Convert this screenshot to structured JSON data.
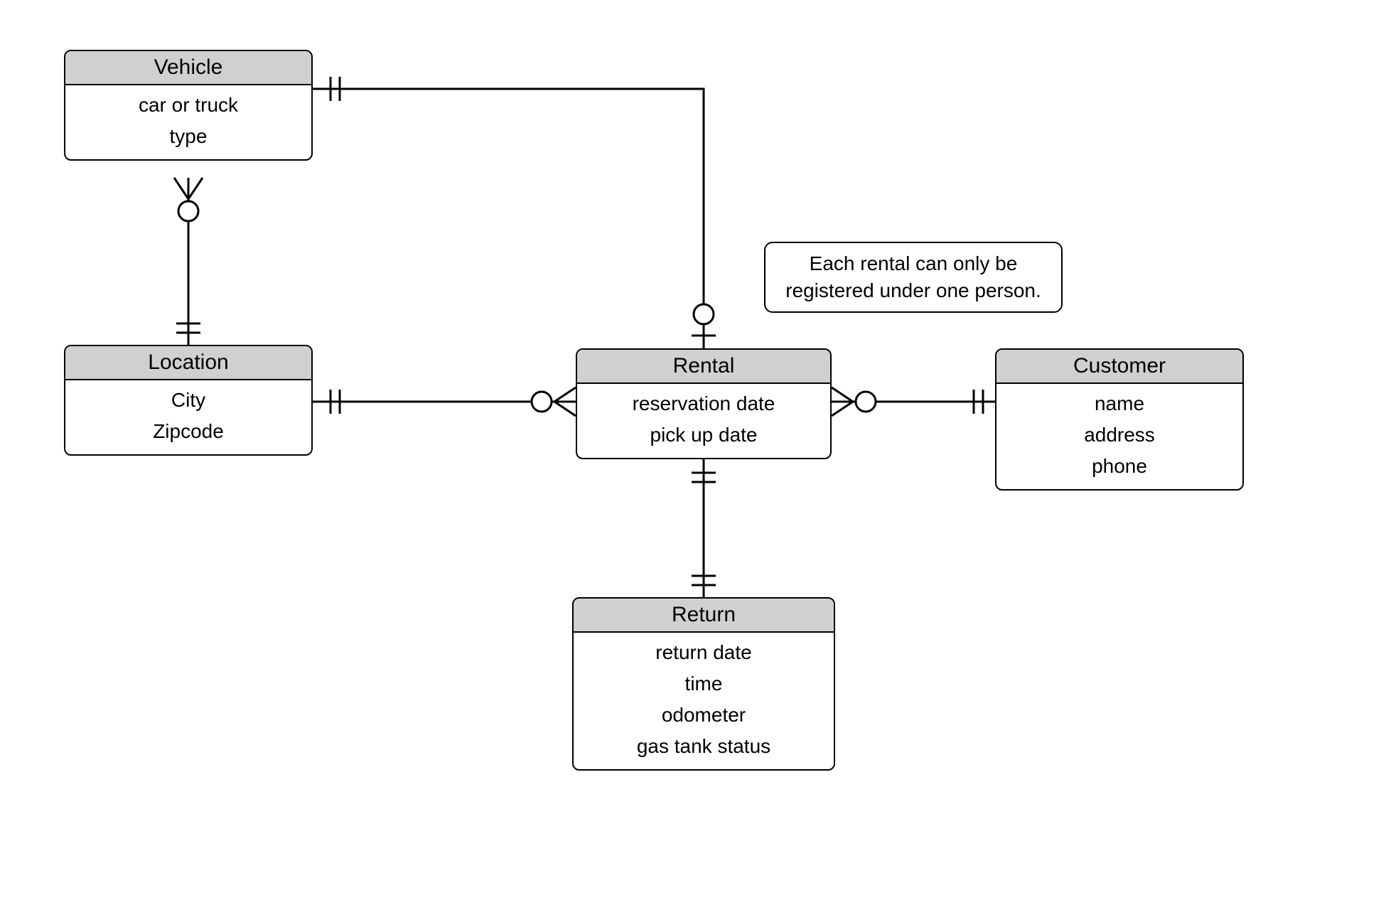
{
  "entities": {
    "vehicle": {
      "title": "Vehicle",
      "attrs": [
        "car or truck",
        "type"
      ]
    },
    "location": {
      "title": "Location",
      "attrs": [
        "City",
        "Zipcode"
      ]
    },
    "rental": {
      "title": "Rental",
      "attrs": [
        "reservation date",
        "pick up date"
      ]
    },
    "customer": {
      "title": "Customer",
      "attrs": [
        "name",
        "address",
        "phone"
      ]
    },
    "return": {
      "title": "Return",
      "attrs": [
        "return date",
        "time",
        "odometer",
        "gas tank status"
      ]
    }
  },
  "note": {
    "line1": "Each rental can only be",
    "line2": "registered under one person."
  },
  "relationships": [
    {
      "from": "Vehicle",
      "to": "Location",
      "from_card": "crows-foot-optional",
      "to_card": "one-mandatory"
    },
    {
      "from": "Vehicle",
      "to": "Rental",
      "from_card": "one-mandatory",
      "to_card": "one-optional"
    },
    {
      "from": "Location",
      "to": "Rental",
      "from_card": "one-mandatory",
      "to_card": "crows-foot-optional"
    },
    {
      "from": "Rental",
      "to": "Customer",
      "from_card": "crows-foot-optional",
      "to_card": "one-mandatory"
    },
    {
      "from": "Rental",
      "to": "Return",
      "from_card": "one-mandatory",
      "to_card": "one-mandatory"
    }
  ]
}
